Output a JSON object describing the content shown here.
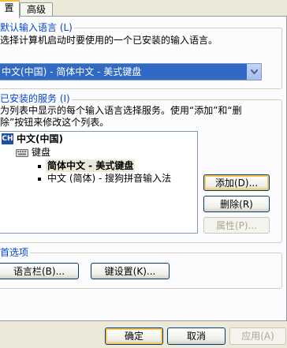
{
  "tabs": [
    {
      "label": "设置",
      "visible": "置"
    },
    {
      "label": "高级"
    }
  ],
  "default_language": {
    "legend": "默认输入语言 (L)",
    "legend_visible": "默认输入语言 (L)",
    "description": "选择计算机启动时要使用的一个已安装的输入语言。",
    "selected": "中文(中国) - 简体中文 - 美式键盘"
  },
  "installed_services": {
    "legend": "已安装的服务 (I)",
    "description_line1": "为列表中显示的每个输入语言选择服务。使用“添加”和“删",
    "description_line2": "除”按钮来修改这个列表。",
    "tree": {
      "language_code": "CH",
      "language": "中文(中国)",
      "category": "键盘",
      "items": [
        "简体中文 - 美式键盘",
        "中文 (简体) - 搜狗拼音输入法"
      ]
    },
    "buttons": {
      "add": "添加(D)...",
      "remove": "删除(R)",
      "properties": "属性(P)..."
    }
  },
  "preferences": {
    "legend": "首选项",
    "language_bar": "语言栏(B)...",
    "key_settings": "键设置(K)..."
  },
  "dialog_buttons": {
    "ok": "确定",
    "cancel": "取消",
    "apply": "应用(A)"
  }
}
